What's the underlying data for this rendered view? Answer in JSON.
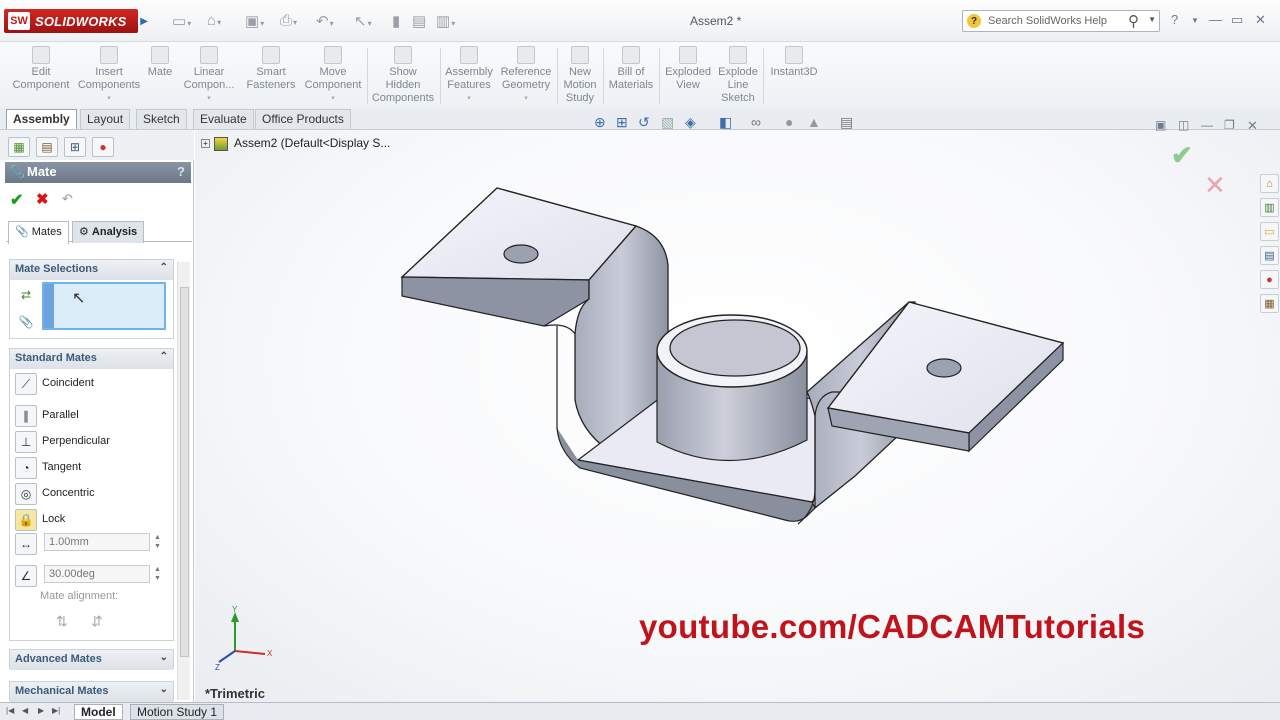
{
  "app": {
    "logo_text": "SOLIDWORKS",
    "logo_badge": "SW",
    "document_title": "Assem2 *"
  },
  "search": {
    "placeholder": "Search SolidWorks Help"
  },
  "ribbon": {
    "tools": [
      {
        "label": "Edit Component",
        "lines": [
          "Edit",
          "Component"
        ]
      },
      {
        "label": "Insert Components",
        "lines": [
          "Insert",
          "Components"
        ]
      },
      {
        "label": "Mate",
        "lines": [
          "Mate"
        ]
      },
      {
        "label": "Linear Component Pattern",
        "lines": [
          "Linear",
          "Compon..."
        ]
      },
      {
        "label": "Smart Fasteners",
        "lines": [
          "Smart",
          "Fasteners"
        ]
      },
      {
        "label": "Move Component",
        "lines": [
          "Move",
          "Component"
        ]
      },
      {
        "label": "Show Hidden Components",
        "lines": [
          "Show",
          "Hidden",
          "Components"
        ]
      },
      {
        "label": "Assembly Features",
        "lines": [
          "Assembly",
          "Features"
        ]
      },
      {
        "label": "Reference Geometry",
        "lines": [
          "Reference",
          "Geometry"
        ]
      },
      {
        "label": "New Motion Study",
        "lines": [
          "New",
          "Motion",
          "Study"
        ]
      },
      {
        "label": "Bill of Materials",
        "lines": [
          "Bill of",
          "Materials"
        ]
      },
      {
        "label": "Exploded View",
        "lines": [
          "Exploded",
          "View"
        ]
      },
      {
        "label": "Explode Line Sketch",
        "lines": [
          "Explode",
          "Line",
          "Sketch"
        ]
      },
      {
        "label": "Instant3D",
        "lines": [
          "Instant3D"
        ]
      }
    ]
  },
  "command_tabs": [
    "Assembly",
    "Layout",
    "Sketch",
    "Evaluate",
    "Office Products"
  ],
  "property_manager": {
    "title": "Mate",
    "help": "?",
    "tabs": [
      "Mates",
      "Analysis"
    ],
    "mate_selections": {
      "title": "Mate Selections"
    },
    "standard_mates": {
      "title": "Standard Mates",
      "items": [
        "Coincident",
        "Parallel",
        "Perpendicular",
        "Tangent",
        "Concentric",
        "Lock"
      ],
      "distance_value": "1.00mm",
      "angle_value": "30.00deg",
      "alignment_label": "Mate alignment:"
    },
    "advanced_mates": {
      "title": "Advanced Mates"
    },
    "mechanical_mates": {
      "title": "Mechanical Mates"
    }
  },
  "viewport": {
    "tree_root": "Assem2  (Default<Display S...",
    "view_orientation": "*Trimetric",
    "watermark": "youtube.com/CADCAMTutorials",
    "triad_axes": {
      "x": "X",
      "y": "Y",
      "z": "Z"
    }
  },
  "bottom_tabs": [
    "Model",
    "Motion Study 1"
  ],
  "colors": {
    "accent": "#c0131b",
    "selection_box": "#dbecf9",
    "header_bar": "#7a8797"
  }
}
